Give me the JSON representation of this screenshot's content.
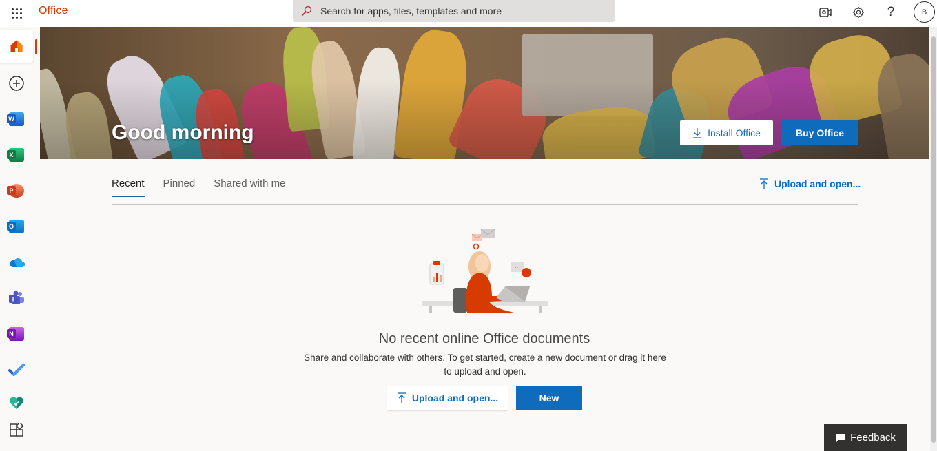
{
  "topbar": {
    "waffle_icon": "app-launcher-icon",
    "brand": "Office",
    "search_placeholder": "Search for apps, files, templates and more",
    "avatar_initial": "B",
    "icons": [
      "meet-now-icon",
      "settings-icon",
      "help-icon"
    ]
  },
  "rail": {
    "items": [
      {
        "name": "home",
        "icon": "home-icon",
        "active": true
      },
      {
        "name": "create",
        "icon": "plus-circle-icon"
      },
      {
        "name": "word",
        "icon": "word-icon",
        "letter": "W",
        "color": "#185abd"
      },
      {
        "name": "excel",
        "icon": "excel-icon",
        "letter": "X",
        "color": "#107c41"
      },
      {
        "name": "powerpoint",
        "icon": "powerpoint-icon",
        "letter": "P",
        "color": "#c43e1c"
      },
      {
        "name": "outlook",
        "icon": "outlook-icon",
        "letter": "O",
        "color": "#0f6cbd"
      },
      {
        "name": "onedrive",
        "icon": "onedrive-icon"
      },
      {
        "name": "teams",
        "icon": "teams-icon"
      },
      {
        "name": "onenote",
        "icon": "onenote-icon",
        "letter": "N",
        "color": "#7719aa"
      },
      {
        "name": "todo",
        "icon": "todo-icon"
      },
      {
        "name": "family-safety",
        "icon": "family-safety-icon"
      },
      {
        "name": "all-apps",
        "icon": "apps-icon"
      }
    ]
  },
  "hero": {
    "greeting": "Good morning",
    "install_label": "Install Office",
    "buy_label": "Buy Office"
  },
  "tabs": {
    "items": [
      "Recent",
      "Pinned",
      "Shared with me"
    ],
    "active": "Recent",
    "upload_label": "Upload and open..."
  },
  "empty_state": {
    "title": "No recent online Office documents",
    "description": "Share and collaborate with others. To get started, create a new document or drag it here to upload and open.",
    "upload_label": "Upload and open...",
    "new_label": "New"
  },
  "feedback": {
    "label": "Feedback"
  },
  "colors": {
    "accent": "#0f6cbd",
    "brand": "#d83b01",
    "feedback_bg": "#323130"
  }
}
